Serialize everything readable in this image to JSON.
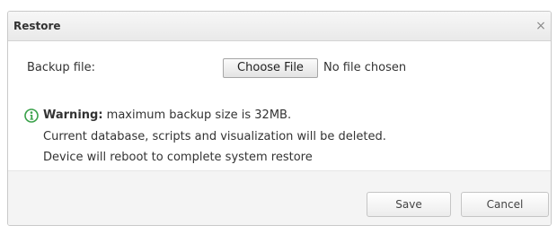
{
  "dialog": {
    "title": "Restore",
    "close_icon": "close-icon",
    "close_glyph": "×"
  },
  "file_row": {
    "label": "Backup file:",
    "choose_button": "Choose File",
    "status": "No file chosen"
  },
  "warning": {
    "icon": "info-icon",
    "bold_label": "Warning:",
    "line1_rest": " maximum backup size is 32MB.",
    "line2": "Current database, scripts and visualization will be deleted.",
    "line3": "Device will reboot to complete system restore",
    "accent_color": "#3aa14a"
  },
  "footer": {
    "save_label": "Save",
    "cancel_label": "Cancel"
  }
}
